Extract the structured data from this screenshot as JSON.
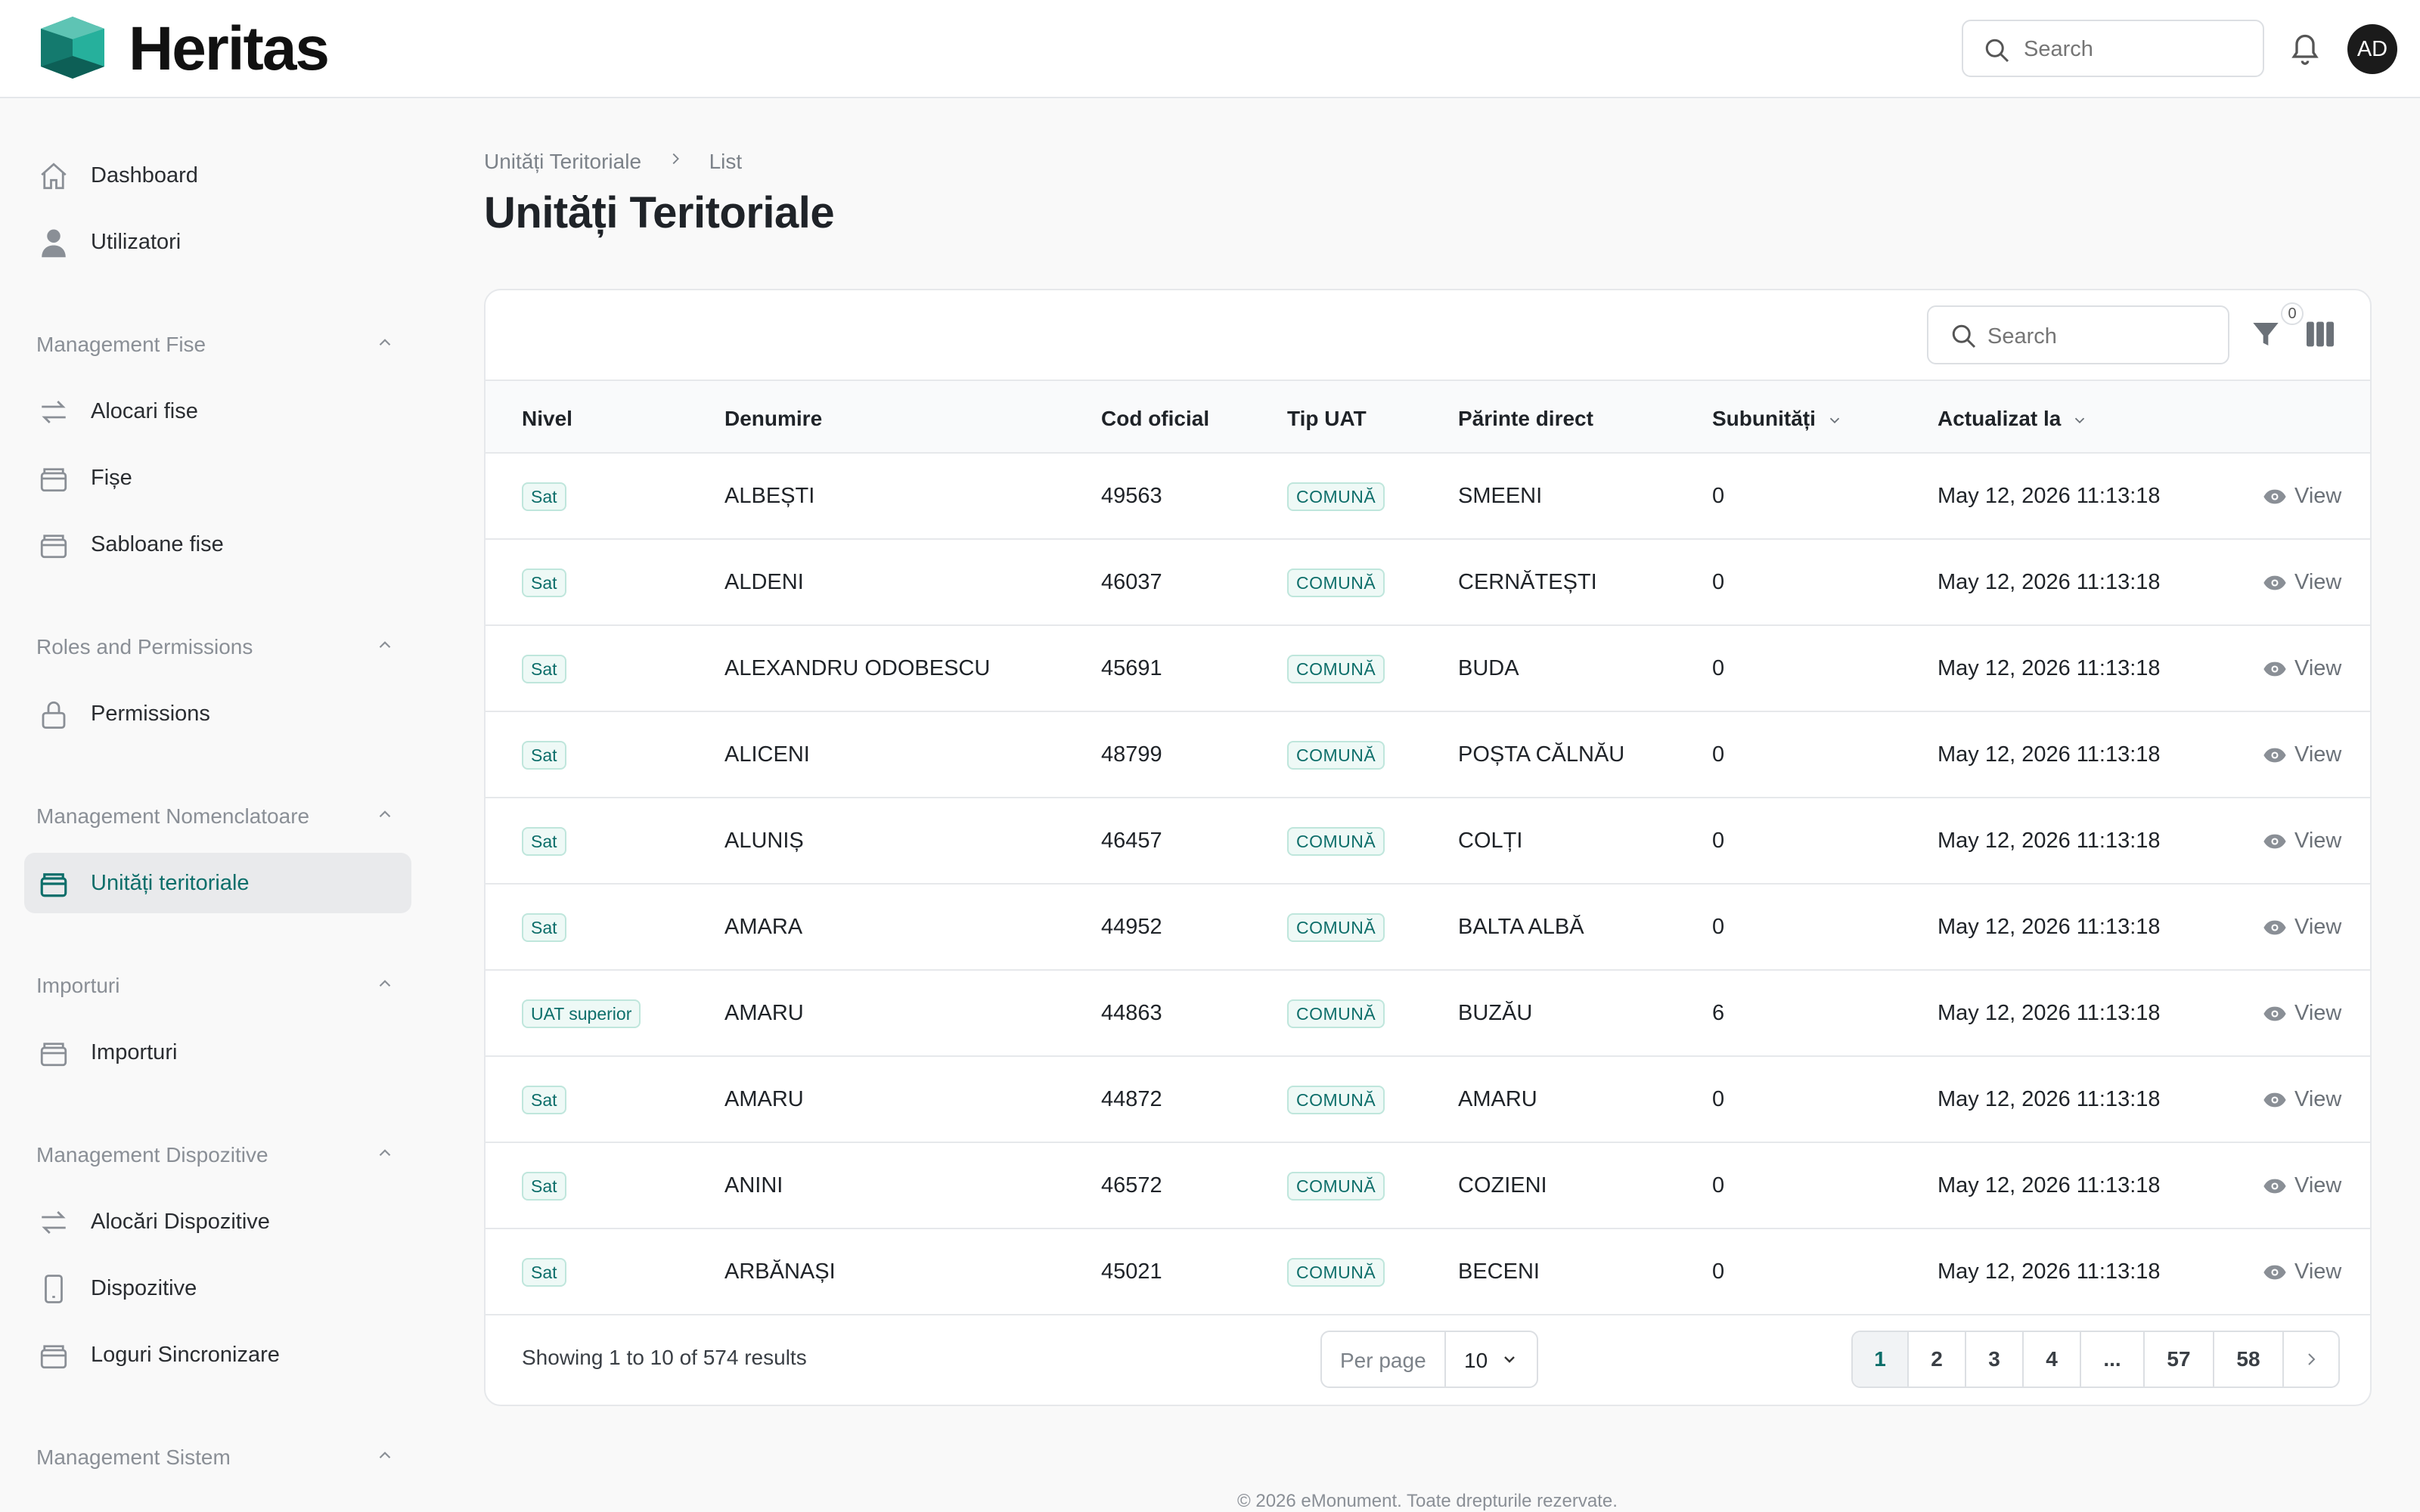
{
  "app": {
    "brand": "Heritas"
  },
  "header": {
    "search_placeholder": "Search",
    "avatar_initials": "AD"
  },
  "sidebar": {
    "top_items": [
      {
        "label": "Dashboard",
        "icon": "home-icon"
      },
      {
        "label": "Utilizatori",
        "icon": "user-icon"
      }
    ],
    "groups": [
      {
        "title": "Management Fise",
        "items": [
          {
            "label": "Alocari fise",
            "icon": "arrows-icon"
          },
          {
            "label": "Fișe",
            "icon": "folder-icon"
          },
          {
            "label": "Sabloane fise",
            "icon": "folder-icon"
          }
        ]
      },
      {
        "title": "Roles and Permissions",
        "items": [
          {
            "label": "Permissions",
            "icon": "lock-icon"
          }
        ]
      },
      {
        "title": "Management Nomenclatoare",
        "items": [
          {
            "label": "Unități teritoriale",
            "icon": "folder-icon",
            "active": true
          }
        ]
      },
      {
        "title": "Importuri",
        "items": [
          {
            "label": "Importuri",
            "icon": "folder-icon"
          }
        ]
      },
      {
        "title": "Management Dispozitive",
        "items": [
          {
            "label": "Alocări Dispozitive",
            "icon": "arrows-icon"
          },
          {
            "label": "Dispozitive",
            "icon": "phone-icon"
          },
          {
            "label": "Loguri Sincronizare",
            "icon": "folder-icon"
          }
        ]
      },
      {
        "title": "Management Sistem",
        "items": []
      }
    ]
  },
  "breadcrumb": {
    "parent": "Unități Teritoriale",
    "current": "List"
  },
  "page": {
    "title": "Unități Teritoriale"
  },
  "table": {
    "search_placeholder": "Search",
    "filter_count": "0",
    "columns": [
      "Nivel",
      "Denumire",
      "Cod oficial",
      "Tip UAT",
      "Părinte direct",
      "Subunități",
      "Actualizat la"
    ],
    "view_label": "View",
    "rows": [
      {
        "nivel": "Sat",
        "denumire": "ALBEȘTI",
        "cod": "49563",
        "tip": "COMUNĂ",
        "parinte": "SMEENI",
        "sub": "0",
        "actualizat": "May 12, 2026 11:13:18"
      },
      {
        "nivel": "Sat",
        "denumire": "ALDENI",
        "cod": "46037",
        "tip": "COMUNĂ",
        "parinte": "CERNĂTEȘTI",
        "sub": "0",
        "actualizat": "May 12, 2026 11:13:18"
      },
      {
        "nivel": "Sat",
        "denumire": "ALEXANDRU ODOBESCU",
        "cod": "45691",
        "tip": "COMUNĂ",
        "parinte": "BUDA",
        "sub": "0",
        "actualizat": "May 12, 2026 11:13:18"
      },
      {
        "nivel": "Sat",
        "denumire": "ALICENI",
        "cod": "48799",
        "tip": "COMUNĂ",
        "parinte": "POȘTA CĂLNĂU",
        "sub": "0",
        "actualizat": "May 12, 2026 11:13:18"
      },
      {
        "nivel": "Sat",
        "denumire": "ALUNIȘ",
        "cod": "46457",
        "tip": "COMUNĂ",
        "parinte": "COLȚI",
        "sub": "0",
        "actualizat": "May 12, 2026 11:13:18"
      },
      {
        "nivel": "Sat",
        "denumire": "AMARA",
        "cod": "44952",
        "tip": "COMUNĂ",
        "parinte": "BALTA ALBĂ",
        "sub": "0",
        "actualizat": "May 12, 2026 11:13:18"
      },
      {
        "nivel": "UAT superior",
        "denumire": "AMARU",
        "cod": "44863",
        "tip": "COMUNĂ",
        "parinte": "BUZĂU",
        "sub": "6",
        "actualizat": "May 12, 2026 11:13:18"
      },
      {
        "nivel": "Sat",
        "denumire": "AMARU",
        "cod": "44872",
        "tip": "COMUNĂ",
        "parinte": "AMARU",
        "sub": "0",
        "actualizat": "May 12, 2026 11:13:18"
      },
      {
        "nivel": "Sat",
        "denumire": "ANINI",
        "cod": "46572",
        "tip": "COMUNĂ",
        "parinte": "COZIENI",
        "sub": "0",
        "actualizat": "May 12, 2026 11:13:18"
      },
      {
        "nivel": "Sat",
        "denumire": "ARBĂNAȘI",
        "cod": "45021",
        "tip": "COMUNĂ",
        "parinte": "BECENI",
        "sub": "0",
        "actualizat": "May 12, 2026 11:13:18"
      }
    ]
  },
  "pagination": {
    "showing": "Showing 1 to 10 of 574 results",
    "per_page_label": "Per page",
    "per_page_value": "10",
    "pages": [
      "1",
      "2",
      "3",
      "4",
      "...",
      "57",
      "58"
    ],
    "current_page": "1"
  },
  "footer": {
    "copyright": "© 2026 eMonument. Toate drepturile rezervate."
  },
  "colors": {
    "accent": "#0d6e6a",
    "badge_bg": "#eef9f6",
    "active_nav_bg": "#e9eaec"
  }
}
